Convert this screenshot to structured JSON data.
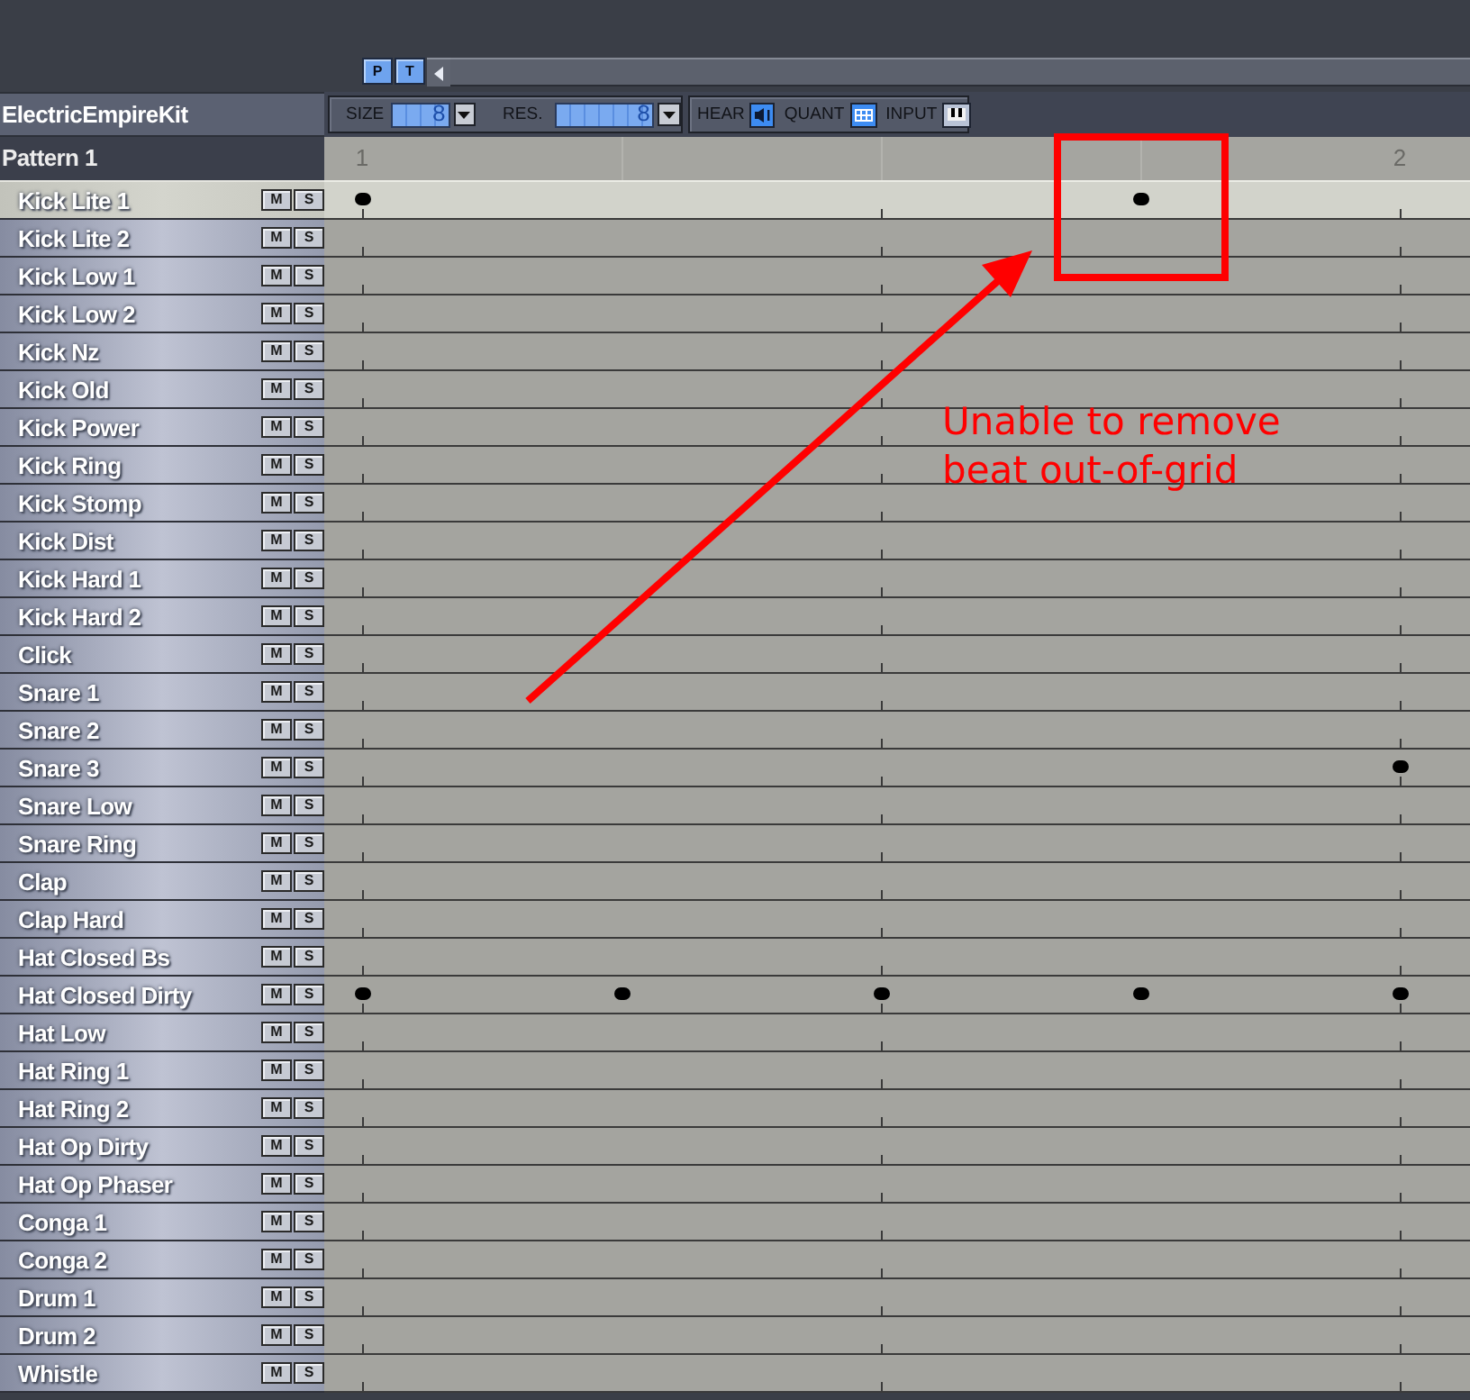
{
  "top_bar": {
    "buttons": [
      {
        "label": "P"
      },
      {
        "label": "T"
      }
    ]
  },
  "kit_name": "ElectricEmpireKit",
  "pattern_name": "Pattern 1",
  "toolbar": {
    "size": {
      "label": "SIZE",
      "value": "8"
    },
    "resolution": {
      "label": "RES.",
      "value": "8"
    },
    "toggles": [
      {
        "kind": "hear",
        "label": "HEAR",
        "on": true
      },
      {
        "kind": "quant",
        "label": "QUANT",
        "on": true
      },
      {
        "kind": "input",
        "label": "INPUT",
        "on": false
      }
    ]
  },
  "ruler": {
    "bar_numbers": [
      "1",
      "2"
    ]
  },
  "tracks": [
    {
      "name": "Kick Lite 1",
      "selected": true,
      "mute": "M",
      "solo": "S",
      "hits": [
        true,
        false,
        false,
        true,
        false
      ]
    },
    {
      "name": "Kick Lite 2",
      "selected": false,
      "mute": "M",
      "solo": "S",
      "hits": [
        false,
        false,
        false,
        false,
        false
      ]
    },
    {
      "name": "Kick Low 1",
      "selected": false,
      "mute": "M",
      "solo": "S",
      "hits": [
        false,
        false,
        false,
        false,
        false
      ]
    },
    {
      "name": "Kick Low 2",
      "selected": false,
      "mute": "M",
      "solo": "S",
      "hits": [
        false,
        false,
        false,
        false,
        false
      ]
    },
    {
      "name": "Kick Nz",
      "selected": false,
      "mute": "M",
      "solo": "S",
      "hits": [
        false,
        false,
        false,
        false,
        false
      ]
    },
    {
      "name": "Kick Old",
      "selected": false,
      "mute": "M",
      "solo": "S",
      "hits": [
        false,
        false,
        false,
        false,
        false
      ]
    },
    {
      "name": "Kick Power",
      "selected": false,
      "mute": "M",
      "solo": "S",
      "hits": [
        false,
        false,
        false,
        false,
        false
      ]
    },
    {
      "name": "Kick Ring",
      "selected": false,
      "mute": "M",
      "solo": "S",
      "hits": [
        false,
        false,
        false,
        false,
        false
      ]
    },
    {
      "name": "Kick Stomp",
      "selected": false,
      "mute": "M",
      "solo": "S",
      "hits": [
        false,
        false,
        false,
        false,
        false
      ]
    },
    {
      "name": "Kick Dist",
      "selected": false,
      "mute": "M",
      "solo": "S",
      "hits": [
        false,
        false,
        false,
        false,
        false
      ]
    },
    {
      "name": "Kick Hard 1",
      "selected": false,
      "mute": "M",
      "solo": "S",
      "hits": [
        false,
        false,
        false,
        false,
        false
      ]
    },
    {
      "name": "Kick Hard 2",
      "selected": false,
      "mute": "M",
      "solo": "S",
      "hits": [
        false,
        false,
        false,
        false,
        false
      ]
    },
    {
      "name": "Click",
      "selected": false,
      "mute": "M",
      "solo": "S",
      "hits": [
        false,
        false,
        false,
        false,
        false
      ]
    },
    {
      "name": "Snare 1",
      "selected": false,
      "mute": "M",
      "solo": "S",
      "hits": [
        false,
        false,
        false,
        false,
        false
      ]
    },
    {
      "name": "Snare 2",
      "selected": false,
      "mute": "M",
      "solo": "S",
      "hits": [
        false,
        false,
        false,
        false,
        false
      ]
    },
    {
      "name": "Snare 3",
      "selected": false,
      "mute": "M",
      "solo": "S",
      "hits": [
        false,
        false,
        false,
        false,
        true
      ]
    },
    {
      "name": "Snare Low",
      "selected": false,
      "mute": "M",
      "solo": "S",
      "hits": [
        false,
        false,
        false,
        false,
        false
      ]
    },
    {
      "name": "Snare Ring",
      "selected": false,
      "mute": "M",
      "solo": "S",
      "hits": [
        false,
        false,
        false,
        false,
        false
      ]
    },
    {
      "name": "Clap",
      "selected": false,
      "mute": "M",
      "solo": "S",
      "hits": [
        false,
        false,
        false,
        false,
        false
      ]
    },
    {
      "name": "Clap Hard",
      "selected": false,
      "mute": "M",
      "solo": "S",
      "hits": [
        false,
        false,
        false,
        false,
        false
      ]
    },
    {
      "name": "Hat Closed Bs",
      "selected": false,
      "mute": "M",
      "solo": "S",
      "hits": [
        false,
        false,
        false,
        false,
        false
      ]
    },
    {
      "name": "Hat Closed Dirty",
      "selected": false,
      "mute": "M",
      "solo": "S",
      "hits": [
        true,
        true,
        true,
        true,
        true
      ]
    },
    {
      "name": "Hat Low",
      "selected": false,
      "mute": "M",
      "solo": "S",
      "hits": [
        false,
        false,
        false,
        false,
        false
      ]
    },
    {
      "name": "Hat Ring 1",
      "selected": false,
      "mute": "M",
      "solo": "S",
      "hits": [
        false,
        false,
        false,
        false,
        false
      ]
    },
    {
      "name": "Hat Ring 2",
      "selected": false,
      "mute": "M",
      "solo": "S",
      "hits": [
        false,
        false,
        false,
        false,
        false
      ]
    },
    {
      "name": "Hat Op Dirty",
      "selected": false,
      "mute": "M",
      "solo": "S",
      "hits": [
        false,
        false,
        false,
        false,
        false
      ]
    },
    {
      "name": "Hat Op Phaser",
      "selected": false,
      "mute": "M",
      "solo": "S",
      "hits": [
        false,
        false,
        false,
        false,
        false
      ]
    },
    {
      "name": "Conga 1",
      "selected": false,
      "mute": "M",
      "solo": "S",
      "hits": [
        false,
        false,
        false,
        false,
        false
      ]
    },
    {
      "name": "Conga 2",
      "selected": false,
      "mute": "M",
      "solo": "S",
      "hits": [
        false,
        false,
        false,
        false,
        false
      ]
    },
    {
      "name": "Drum 1",
      "selected": false,
      "mute": "M",
      "solo": "S",
      "hits": [
        false,
        false,
        false,
        false,
        false
      ]
    },
    {
      "name": "Drum 2",
      "selected": false,
      "mute": "M",
      "solo": "S",
      "hits": [
        false,
        false,
        false,
        false,
        false
      ]
    },
    {
      "name": "Whistle",
      "selected": false,
      "mute": "M",
      "solo": "S",
      "hits": [
        false,
        false,
        false,
        false,
        false
      ]
    }
  ],
  "annotation": {
    "lines": [
      "Unable to remove",
      "beat out-of-grid"
    ]
  }
}
